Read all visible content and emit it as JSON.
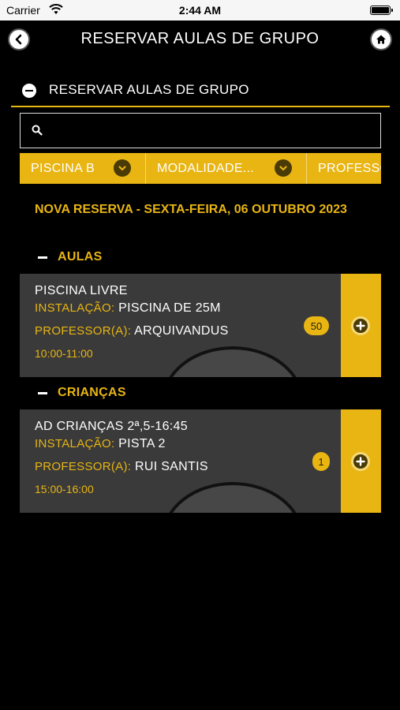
{
  "status_bar": {
    "carrier": "Carrier",
    "time": "2:44 AM"
  },
  "header": {
    "title": "RESERVAR AULAS DE GRUPO",
    "back_icon": "chevron-left-icon",
    "home_icon": "home-icon"
  },
  "section": {
    "label": "RESERVAR AULAS DE GRUPO"
  },
  "search": {
    "value": "",
    "placeholder": ""
  },
  "filters": [
    {
      "label": "PISCINA B"
    },
    {
      "label": "MODALIDADE..."
    },
    {
      "label": "PROFESSOR"
    }
  ],
  "date_heading": "NOVA RESERVA - SEXTA-FEIRA, 06 OUTUBRO 2023",
  "groups": [
    {
      "label": "AULAS",
      "classes": [
        {
          "name": "PISCINA LIVRE",
          "installation_key": "INSTALAÇÃO:",
          "installation": "PISCINA DE 25M",
          "teacher_key": "PROFESSOR(A):",
          "teacher": "ARQUIVANDUS",
          "time": "10:00-11:00",
          "count": "50"
        }
      ]
    },
    {
      "label": "CRIANÇAS",
      "classes": [
        {
          "name": "AD CRIANÇAS 2ª,5-16:45",
          "installation_key": "INSTALAÇÃO:",
          "installation": "PISTA 2",
          "teacher_key": "PROFESSOR(A):",
          "teacher": "RUI SANTIS",
          "time": "15:00-16:00",
          "count": "1"
        }
      ]
    }
  ],
  "colors": {
    "accent": "#e8b513",
    "background": "#000000",
    "card": "#3a3a3a"
  }
}
